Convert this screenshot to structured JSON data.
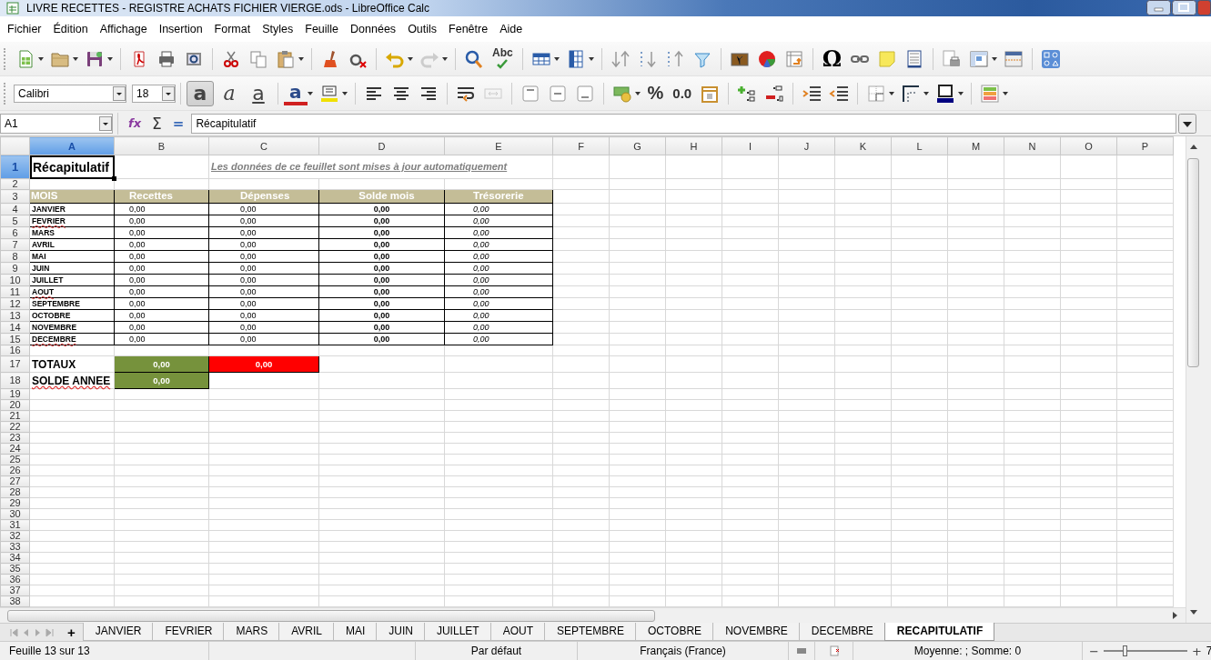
{
  "window": {
    "title": "LIVRE RECETTES - REGISTRE ACHATS FICHIER VIERGE.ods - LibreOffice Calc"
  },
  "menu": [
    "Fichier",
    "Édition",
    "Affichage",
    "Insertion",
    "Format",
    "Styles",
    "Feuille",
    "Données",
    "Outils",
    "Fenêtre",
    "Aide"
  ],
  "standard_toolbar": {
    "spellcheck_label": "Abc",
    "special_character": "Ω"
  },
  "format_toolbar": {
    "font_name": "Calibri",
    "font_size": "18",
    "style_buttons": [
      {
        "kind": "bold",
        "glyph": "a",
        "selected": true
      },
      {
        "kind": "italic",
        "glyph": "a",
        "selected": false
      },
      {
        "kind": "underline",
        "glyph": "a",
        "selected": false
      }
    ],
    "font_color_glyph": "a",
    "percent": "%",
    "number_format": "0.0"
  },
  "formula_bar": {
    "cell_ref": "A1",
    "buttons": [
      "fx",
      "Σ",
      "="
    ],
    "content": "Récapitulatif"
  },
  "sheet": {
    "columns": [
      {
        "letter": "A",
        "selected": true
      },
      {
        "letter": "B",
        "selected": false
      },
      {
        "letter": "C",
        "selected": false
      },
      {
        "letter": "D",
        "selected": false
      },
      {
        "letter": "E",
        "selected": false
      },
      {
        "letter": "F",
        "selected": false
      },
      {
        "letter": "G",
        "selected": false
      },
      {
        "letter": "H",
        "selected": false
      },
      {
        "letter": "I",
        "selected": false
      },
      {
        "letter": "J",
        "selected": false
      },
      {
        "letter": "K",
        "selected": false
      },
      {
        "letter": "L",
        "selected": false
      },
      {
        "letter": "M",
        "selected": false
      },
      {
        "letter": "N",
        "selected": false
      },
      {
        "letter": "O",
        "selected": false
      },
      {
        "letter": "P",
        "selected": false
      }
    ],
    "rows": [
      {
        "number": "1",
        "selected": true,
        "kind": "title",
        "title": "Récapitulatif",
        "note": "Les données de ce feuillet sont mises à jour automatiquement"
      },
      {
        "number": "2",
        "selected": false,
        "kind": "gap"
      },
      {
        "number": "3",
        "selected": false,
        "kind": "header",
        "cells": [
          "MOIS",
          "Recettes",
          "Dépenses",
          "Solde mois",
          "Trésorerie"
        ]
      },
      {
        "number": "4",
        "selected": false,
        "kind": "month",
        "month": "JANVIER",
        "spell_error": false,
        "recettes": "0,00",
        "depenses": "0,00",
        "solde": "0,00",
        "tresorerie": "0,00"
      },
      {
        "number": "5",
        "selected": false,
        "kind": "month",
        "month": "FEVRIER",
        "spell_error": true,
        "recettes": "0,00",
        "depenses": "0,00",
        "solde": "0,00",
        "tresorerie": "0,00"
      },
      {
        "number": "6",
        "selected": false,
        "kind": "month",
        "month": "MARS",
        "spell_error": false,
        "recettes": "0,00",
        "depenses": "0,00",
        "solde": "0,00",
        "tresorerie": "0,00"
      },
      {
        "number": "7",
        "selected": false,
        "kind": "month",
        "month": "AVRIL",
        "spell_error": false,
        "recettes": "0,00",
        "depenses": "0,00",
        "solde": "0,00",
        "tresorerie": "0,00"
      },
      {
        "number": "8",
        "selected": false,
        "kind": "month",
        "month": "MAI",
        "spell_error": false,
        "recettes": "0,00",
        "depenses": "0,00",
        "solde": "0,00",
        "tresorerie": "0,00"
      },
      {
        "number": "9",
        "selected": false,
        "kind": "month",
        "month": "JUIN",
        "spell_error": false,
        "recettes": "0,00",
        "depenses": "0,00",
        "solde": "0,00",
        "tresorerie": "0,00"
      },
      {
        "number": "10",
        "selected": false,
        "kind": "month",
        "month": "JUILLET",
        "spell_error": false,
        "recettes": "0,00",
        "depenses": "0,00",
        "solde": "0,00",
        "tresorerie": "0,00"
      },
      {
        "number": "11",
        "selected": false,
        "kind": "month",
        "month": "AOUT",
        "spell_error": true,
        "recettes": "0,00",
        "depenses": "0,00",
        "solde": "0,00",
        "tresorerie": "0,00"
      },
      {
        "number": "12",
        "selected": false,
        "kind": "month",
        "month": "SEPTEMBRE",
        "spell_error": false,
        "recettes": "0,00",
        "depenses": "0,00",
        "solde": "0,00",
        "tresorerie": "0,00"
      },
      {
        "number": "13",
        "selected": false,
        "kind": "month",
        "month": "OCTOBRE",
        "spell_error": false,
        "recettes": "0,00",
        "depenses": "0,00",
        "solde": "0,00",
        "tresorerie": "0,00"
      },
      {
        "number": "14",
        "selected": false,
        "kind": "month",
        "month": "NOVEMBRE",
        "spell_error": false,
        "recettes": "0,00",
        "depenses": "0,00",
        "solde": "0,00",
        "tresorerie": "0,00"
      },
      {
        "number": "15",
        "selected": false,
        "kind": "month",
        "month": "DECEMBRE",
        "spell_error": true,
        "recettes": "0,00",
        "depenses": "0,00",
        "solde": "0,00",
        "tresorerie": "0,00"
      },
      {
        "number": "16",
        "selected": false,
        "kind": "spacer"
      },
      {
        "number": "17",
        "selected": false,
        "kind": "total",
        "label": "TOTAUX",
        "spell_error": false,
        "values": [
          {
            "text": "0,00",
            "color": "#76923c"
          },
          {
            "text": "0,00",
            "color": "#ff0000"
          }
        ]
      },
      {
        "number": "18",
        "selected": false,
        "kind": "total",
        "label": "SOLDE ANNEE",
        "spell_error": true,
        "values": [
          {
            "text": "0,00",
            "color": "#76923c"
          }
        ]
      },
      {
        "number": "19",
        "selected": false,
        "kind": "empty"
      },
      {
        "number": "20",
        "selected": false,
        "kind": "empty"
      },
      {
        "number": "21",
        "selected": false,
        "kind": "empty"
      },
      {
        "number": "22",
        "selected": false,
        "kind": "empty"
      },
      {
        "number": "23",
        "selected": false,
        "kind": "empty"
      },
      {
        "number": "24",
        "selected": false,
        "kind": "empty"
      },
      {
        "number": "25",
        "selected": false,
        "kind": "empty"
      },
      {
        "number": "26",
        "selected": false,
        "kind": "empty"
      },
      {
        "number": "27",
        "selected": false,
        "kind": "empty"
      },
      {
        "number": "28",
        "selected": false,
        "kind": "empty"
      },
      {
        "number": "29",
        "selected": false,
        "kind": "empty"
      },
      {
        "number": "30",
        "selected": false,
        "kind": "empty"
      },
      {
        "number": "31",
        "selected": false,
        "kind": "empty"
      },
      {
        "number": "32",
        "selected": false,
        "kind": "empty"
      },
      {
        "number": "33",
        "selected": false,
        "kind": "empty"
      },
      {
        "number": "34",
        "selected": false,
        "kind": "empty"
      },
      {
        "number": "35",
        "selected": false,
        "kind": "empty"
      },
      {
        "number": "36",
        "selected": false,
        "kind": "empty"
      },
      {
        "number": "37",
        "selected": false,
        "kind": "empty"
      },
      {
        "number": "38",
        "selected": false,
        "kind": "empty"
      }
    ]
  },
  "sheet_tabs": {
    "add_label": "+",
    "tabs": [
      {
        "label": "JANVIER",
        "selected": false
      },
      {
        "label": "FEVRIER",
        "selected": false
      },
      {
        "label": "MARS",
        "selected": false
      },
      {
        "label": "AVRIL",
        "selected": false
      },
      {
        "label": "MAI",
        "selected": false
      },
      {
        "label": "JUIN",
        "selected": false
      },
      {
        "label": "JUILLET",
        "selected": false
      },
      {
        "label": "AOUT",
        "selected": false
      },
      {
        "label": "SEPTEMBRE",
        "selected": false
      },
      {
        "label": "OCTOBRE",
        "selected": false
      },
      {
        "label": "NOVEMBRE",
        "selected": false
      },
      {
        "label": "DECEMBRE",
        "selected": false
      },
      {
        "label": "RECAPITULATIF",
        "selected": true
      }
    ]
  },
  "status_bar": {
    "sheet_position": "Feuille 13 sur 13",
    "page_style": "Par défaut",
    "language": "Français (France)",
    "summary": "Moyenne: ; Somme: 0",
    "zoom": {
      "minus": "−",
      "plus": "+",
      "level": 0.25,
      "percent": "7"
    }
  }
}
